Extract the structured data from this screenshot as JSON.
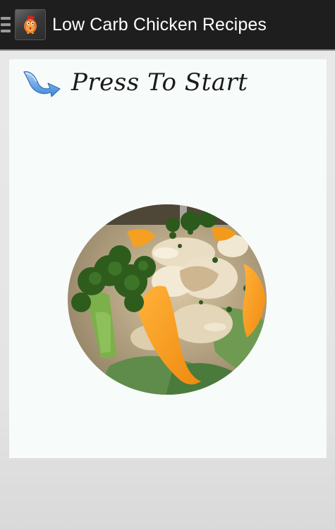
{
  "action_bar": {
    "title": "Low Carb Chicken Recipes",
    "background_color": "#1e1e1e",
    "app_icon": "chicken-icon",
    "menu_icon": "drawer-menu-icon"
  },
  "main": {
    "start_label": "Press To Start",
    "start_icon": "curved-arrow-icon",
    "photo": "chicken-salad-photo",
    "panel_color": "#f7fbf9"
  }
}
